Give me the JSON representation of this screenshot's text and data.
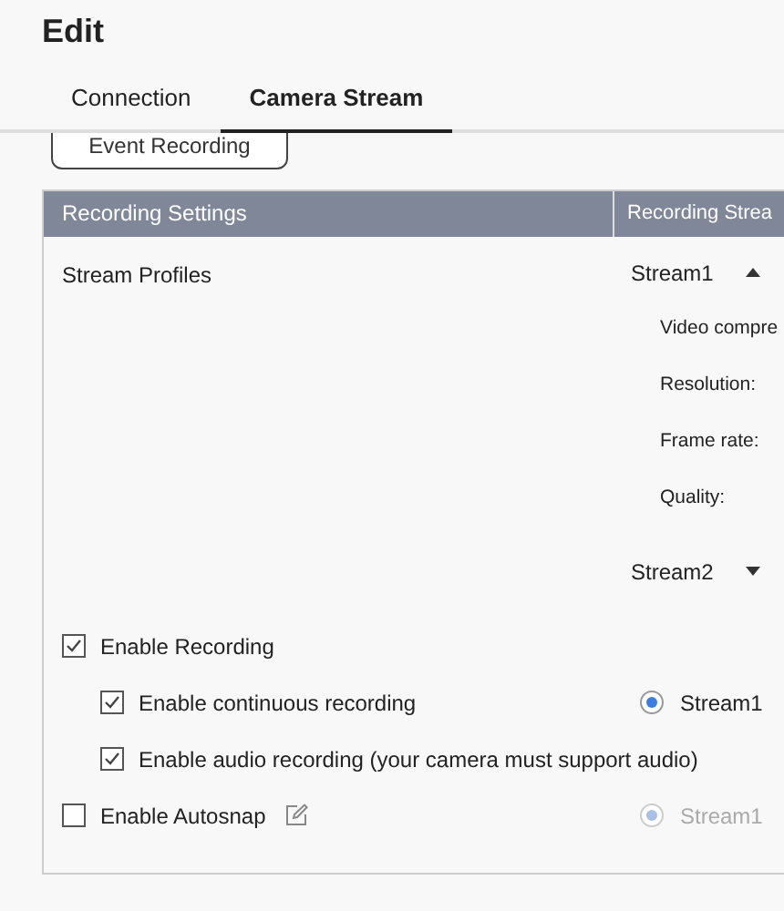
{
  "title": "Edit",
  "tabs": [
    {
      "label": "Connection",
      "selected": false
    },
    {
      "label": "Camera Stream",
      "selected": true
    }
  ],
  "event_button": {
    "label": "Event Recording"
  },
  "table": {
    "columns": [
      "Recording Settings",
      "Recording Strea"
    ],
    "stream_profiles": {
      "label": "Stream Profiles",
      "streams": [
        {
          "name": "Stream1",
          "expanded": true,
          "fields": [
            "Video compre",
            "Resolution:",
            "Frame rate:",
            "Quality:"
          ]
        },
        {
          "name": "Stream2",
          "expanded": false
        }
      ]
    }
  },
  "options": [
    {
      "label": "Enable Recording",
      "checked": true,
      "indented": false
    },
    {
      "label": "Enable continuous recording",
      "checked": true,
      "indented": true,
      "stream": {
        "label": "Stream1",
        "selected": true,
        "disabled": false
      }
    },
    {
      "label": "Enable audio recording (your camera must support audio)",
      "checked": true,
      "indented": true
    },
    {
      "label": "Enable Autosnap",
      "checked": false,
      "indented": false,
      "editable": true,
      "stream": {
        "label": "Stream1",
        "selected": true,
        "disabled": true
      }
    }
  ]
}
